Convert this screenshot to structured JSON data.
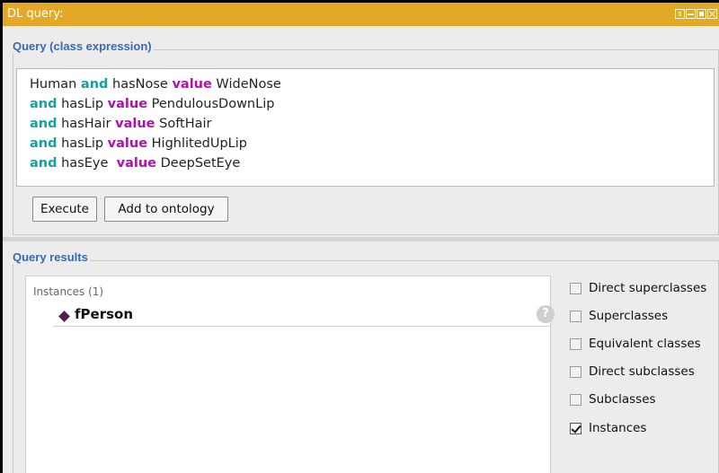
{
  "window": {
    "title": "DL query:"
  },
  "query": {
    "group_title": "Query (class expression)",
    "lines": [
      [
        {
          "t": "Human ",
          "k": "plain"
        },
        {
          "t": "and",
          "k": "and"
        },
        {
          "t": " hasNose ",
          "k": "plain"
        },
        {
          "t": "value",
          "k": "value"
        },
        {
          "t": " WideNose",
          "k": "plain"
        }
      ],
      [
        {
          "t": "and",
          "k": "and"
        },
        {
          "t": " hasLip ",
          "k": "plain"
        },
        {
          "t": "value",
          "k": "value"
        },
        {
          "t": " PendulousDownLip",
          "k": "plain"
        }
      ],
      [
        {
          "t": "and",
          "k": "and"
        },
        {
          "t": " hasHair ",
          "k": "plain"
        },
        {
          "t": "value",
          "k": "value"
        },
        {
          "t": " SoftHair",
          "k": "plain"
        }
      ],
      [
        {
          "t": "and",
          "k": "and"
        },
        {
          "t": " hasLip ",
          "k": "plain"
        },
        {
          "t": "value",
          "k": "value"
        },
        {
          "t": " HighlitedUpLip",
          "k": "plain"
        }
      ],
      [
        {
          "t": "and",
          "k": "and"
        },
        {
          "t": " hasEye  ",
          "k": "plain"
        },
        {
          "t": "value",
          "k": "value"
        },
        {
          "t": " DeepSetEye",
          "k": "plain"
        }
      ]
    ],
    "execute_label": "Execute",
    "add_label": "Add to ontology"
  },
  "results": {
    "group_title": "Query results",
    "header": "Instances (1)",
    "items": [
      {
        "label": "fPerson",
        "icon": "individual-diamond-icon"
      }
    ],
    "help_glyph": "?"
  },
  "options": [
    {
      "label": "Direct superclasses",
      "checked": false
    },
    {
      "label": "Superclasses",
      "checked": false
    },
    {
      "label": "Equivalent classes",
      "checked": false
    },
    {
      "label": "Direct subclasses",
      "checked": false
    },
    {
      "label": "Subclasses",
      "checked": false
    },
    {
      "label": "Instances",
      "checked": true
    }
  ],
  "colors": {
    "titlebar": "#e2a826",
    "group_title": "#3a68b8",
    "keyword_and": "#13a2a2",
    "keyword_value": "#b110b0"
  }
}
